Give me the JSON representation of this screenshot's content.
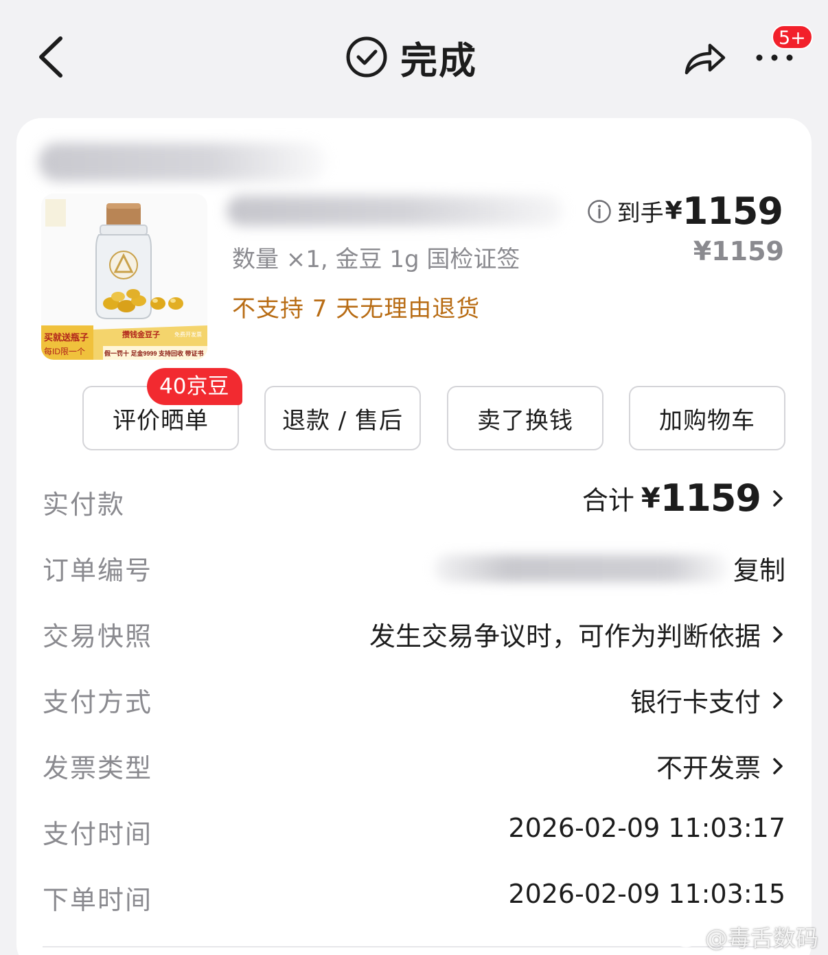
{
  "header": {
    "title": "完成",
    "notification_badge": "5+"
  },
  "product": {
    "spec": "数量 ×1, 金豆 1g 国检证签",
    "return_policy": "不支持 7 天无理由退货",
    "final_price_label": "到手",
    "final_price_currency": "¥",
    "final_price": "1159",
    "original_price": "¥1159",
    "image_banner_left_line1": "买就送瓶子",
    "image_banner_left_line2": "每ID限一个",
    "image_banner_right_line1": "攒钱金豆子",
    "image_banner_right_tag": "免费开发票",
    "image_banner_right_line2": "假一罚十 足金9999 支持回收 带证书"
  },
  "actions": {
    "review": "评价晒单",
    "review_reward": "40京豆",
    "refund": "退款 / 售后",
    "resell": "卖了换钱",
    "add_cart": "加购物车"
  },
  "info": {
    "paid_label": "实付款",
    "total_label": "合计",
    "total_currency": "¥",
    "total_amount": "1159",
    "order_no_label": "订单编号",
    "copy": "复制",
    "snapshot_label": "交易快照",
    "snapshot_value": "发生交易争议时，可作为判断依据",
    "payment_method_label": "支付方式",
    "payment_method_value": "银行卡支付",
    "invoice_label": "发票类型",
    "invoice_value": "不开发票",
    "pay_time_label": "支付时间",
    "pay_time_value": "2026-02-09 11:03:17",
    "order_time_label": "下单时间",
    "order_time_value": "2026-02-09 11:03:15"
  },
  "watermark": "@毒舌数码",
  "colors": {
    "accent_red": "#f22a30",
    "warning_orange": "#b86c14",
    "muted_gray": "#8a8a8f"
  }
}
